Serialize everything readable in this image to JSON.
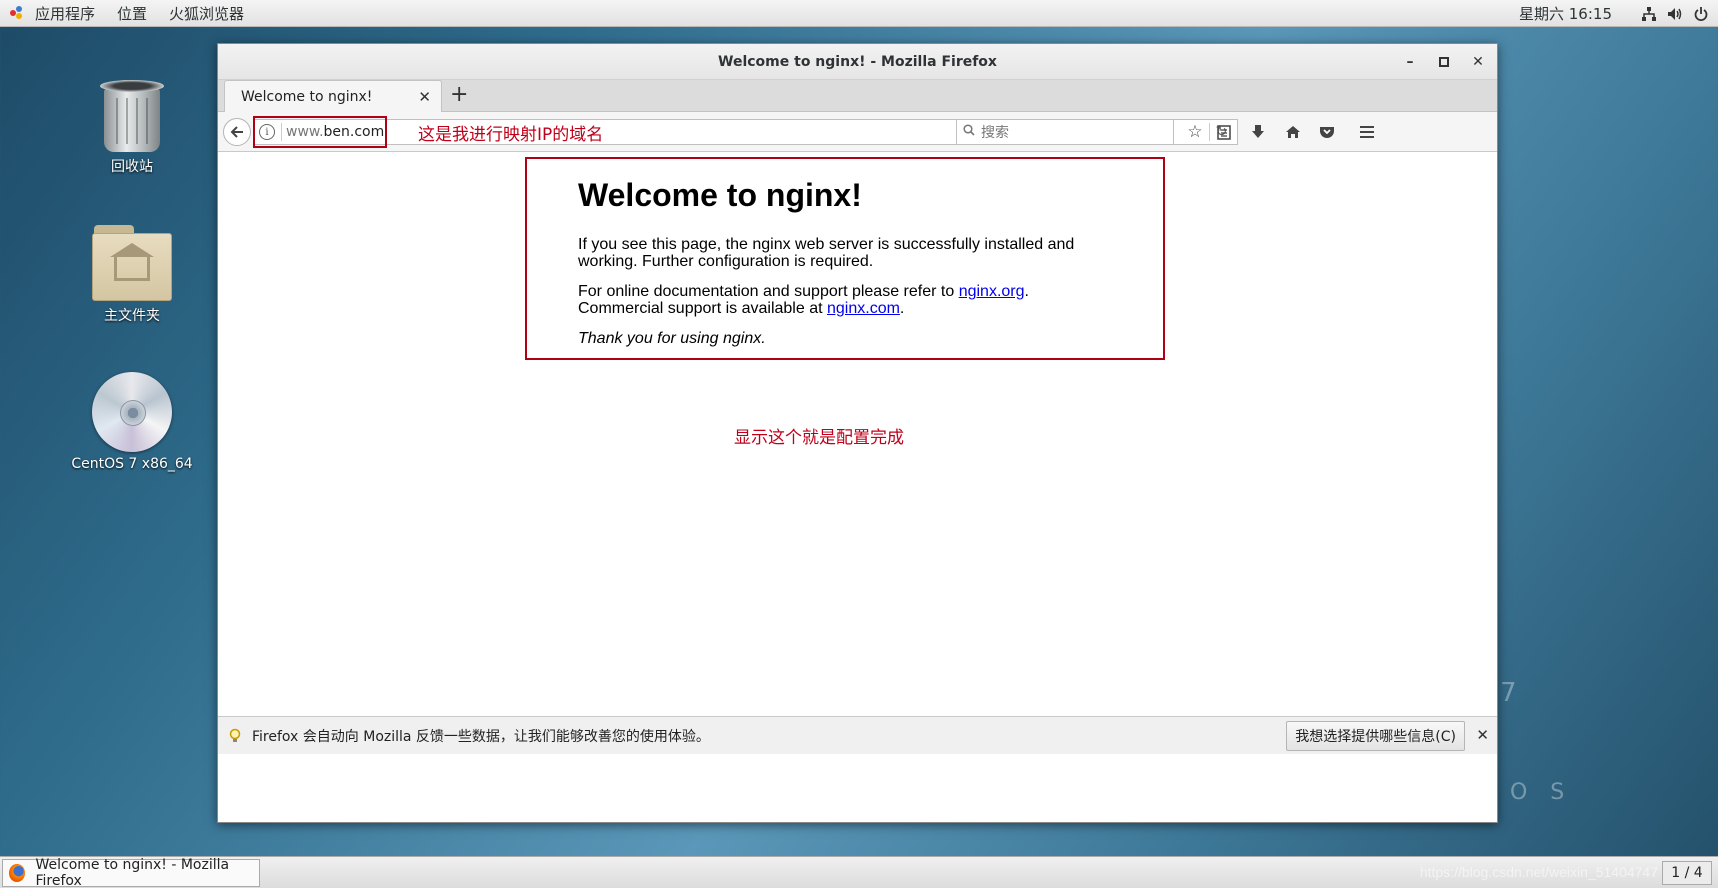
{
  "topbar": {
    "menu": [
      "应用程序",
      "位置",
      "火狐浏览器"
    ],
    "clock": "星期六 16:15",
    "tray_icons": [
      "network-icon",
      "volume-icon",
      "power-icon"
    ]
  },
  "desktop": {
    "icons": [
      {
        "label": "回收站",
        "icon": "trash-icon"
      },
      {
        "label": "主文件夹",
        "icon": "home-folder-icon"
      },
      {
        "label": "CentOS 7 x86_64",
        "icon": "disc-icon"
      }
    ]
  },
  "window": {
    "title": "Welcome to nginx! - Mozilla Firefox",
    "tab_title": "Welcome to nginx!",
    "url_prefix": "www.",
    "url_domain": "ben.com",
    "search_placeholder": "搜索",
    "annotation_url": "这是我进行映射IP的域名",
    "annotation_done": "显示这个就是配置完成",
    "page": {
      "heading": "Welcome to nginx!",
      "para1": "If you see this page, the nginx web server is successfully installed and working. Further configuration is required.",
      "para2_prefix": "For online documentation and support please refer to ",
      "link1": "nginx.org",
      "para2_mid": ".",
      "para3_prefix": "Commercial support is available at ",
      "link2": "nginx.com",
      "para3_suffix": ".",
      "thanks": "Thank you for using nginx."
    },
    "notification": {
      "text": "Firefox 会自动向 Mozilla 反馈一些数据，让我们能够改善您的使用体验。",
      "button": "我想选择提供哪些信息(C)"
    }
  },
  "taskbar": {
    "task_label": "Welcome to nginx! - Mozilla Firefox",
    "pager": "1 / 4",
    "watermark": "https://blog.csdn.net/weixin_51404747"
  },
  "colors": {
    "annotation_red": "#c0001a",
    "link_blue": "#0000ee"
  }
}
